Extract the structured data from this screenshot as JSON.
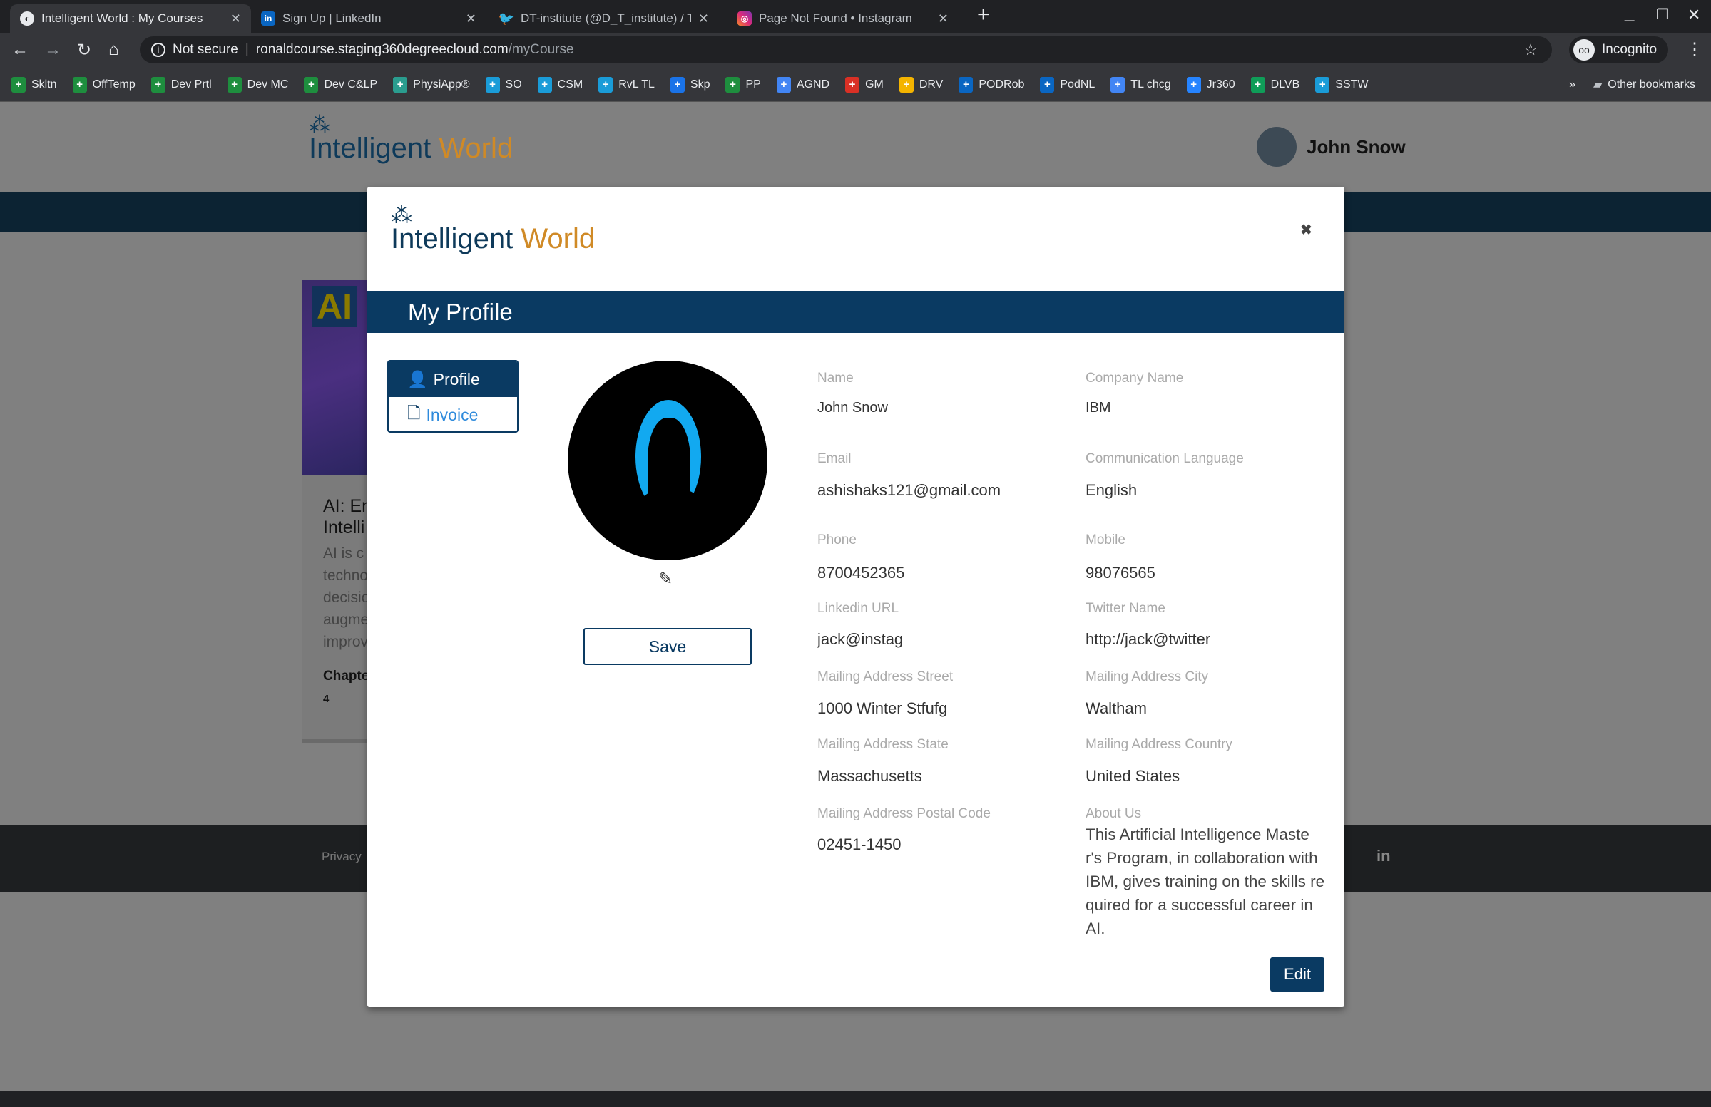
{
  "browser": {
    "tabs": [
      {
        "title": "Intelligent World : My Courses",
        "icon": "globe-icon",
        "active": true
      },
      {
        "title": "Sign Up | LinkedIn",
        "icon": "linkedin-icon"
      },
      {
        "title": "DT-institute (@D_T_institute) / Tw",
        "icon": "twitter-icon"
      },
      {
        "title": "Page Not Found • Instagram",
        "icon": "instagram-icon"
      }
    ],
    "security": "Not secure",
    "url_host": "ronaldcourse.staging360degreecloud.com",
    "url_path": "/myCourse",
    "profile": "Incognito",
    "bookmarks": [
      {
        "label": "Skltn",
        "color": "#1e8e3e"
      },
      {
        "label": "OffTemp",
        "color": "#1e8e3e"
      },
      {
        "label": "Dev Prtl",
        "color": "#1e8e3e"
      },
      {
        "label": "Dev MC",
        "color": "#1e8e3e"
      },
      {
        "label": "Dev C&LP",
        "color": "#1e8e3e"
      },
      {
        "label": "PhysiApp®",
        "color": "#2a9d8f"
      },
      {
        "label": "SO",
        "color": "#1a9cd8"
      },
      {
        "label": "CSM",
        "color": "#1a9cd8"
      },
      {
        "label": "RvL TL",
        "color": "#1a9cd8"
      },
      {
        "label": "Skp",
        "color": "#1a73e8"
      },
      {
        "label": "PP",
        "color": "#1e8e3e"
      },
      {
        "label": "AGND",
        "color": "#4285f4"
      },
      {
        "label": "GM",
        "color": "#d93025"
      },
      {
        "label": "DRV",
        "color": "#f4b400"
      },
      {
        "label": "PODRob",
        "color": "#0a66c2"
      },
      {
        "label": "PodNL",
        "color": "#0a66c2"
      },
      {
        "label": "TL chcg",
        "color": "#4285f4"
      },
      {
        "label": "Jr360",
        "color": "#2684ff"
      },
      {
        "label": "DLVB",
        "color": "#0f9d58"
      },
      {
        "label": "SSTW",
        "color": "#1a9cd8"
      }
    ],
    "other_bookmarks": "Other bookmarks"
  },
  "site": {
    "logo_a": "Intelligent",
    "logo_b": "World",
    "user_name": "John Snow",
    "course_badge": "AI",
    "course_title_1": "AI: En",
    "course_title_2": "Intelli",
    "course_desc": [
      "AI is c",
      "techno",
      "decisio",
      "augme",
      "improv"
    ],
    "chapters_label": "Chapte",
    "chapters_value": "4",
    "footer_privacy": "Privacy",
    "footer_social": "in"
  },
  "modal": {
    "logo_a": "Intelligent",
    "logo_b": "World",
    "title": "My Profile",
    "tab_profile": "Profile",
    "tab_invoice": "Invoice",
    "save": "Save",
    "edit": "Edit",
    "fields": [
      {
        "label": "Name",
        "value": "John Snow"
      },
      {
        "label": "Company Name",
        "value": "IBM"
      },
      {
        "label": "Email",
        "value": "ashishaks121@gmail.com"
      },
      {
        "label": "Communication Language",
        "value": "English"
      },
      {
        "label": "Phone",
        "value": "8700452365"
      },
      {
        "label": "Mobile",
        "value": "98076565"
      },
      {
        "label": "Linkedin URL",
        "value": "jack@instag"
      },
      {
        "label": "Twitter Name",
        "value": "http://jack@twitter"
      },
      {
        "label": "Mailing Address Street",
        "value": "1000 Winter Stfufg"
      },
      {
        "label": "Mailing Address City",
        "value": "Waltham"
      },
      {
        "label": "Mailing Address State",
        "value": "Massachusetts"
      },
      {
        "label": "Mailing Address Country",
        "value": "United States"
      },
      {
        "label": "Mailing Address Postal Code",
        "value": "02451-1450"
      },
      {
        "label": "About Us",
        "value": "This Artificial Intelligence Master's Program, in collaboration with IBM, gives training on the skills required for a successful career in AI."
      }
    ]
  }
}
